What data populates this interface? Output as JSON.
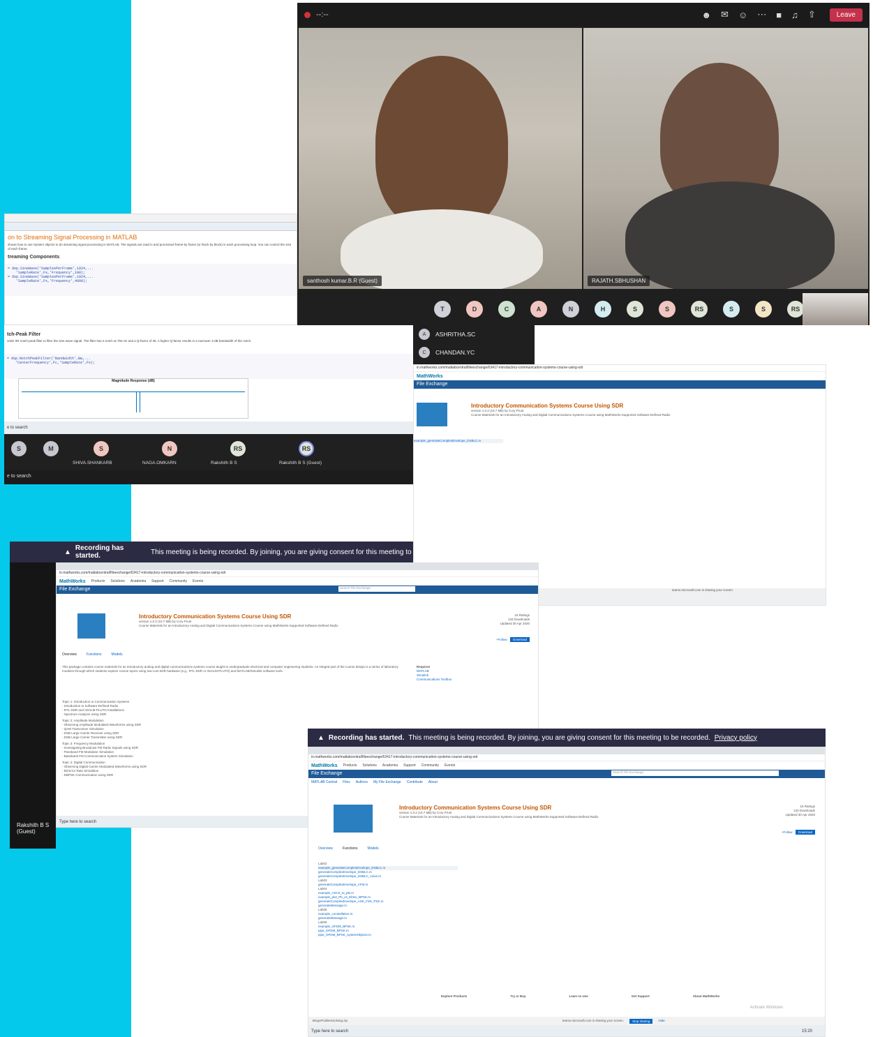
{
  "video_call": {
    "meeting_time": "--:--",
    "leave_label": "Leave",
    "tiles": [
      {
        "name": "santhosh kumar.B.R (Guest)"
      },
      {
        "name": "RAJATH.SBHUSHAN"
      }
    ],
    "avatars": [
      "T",
      "D",
      "C",
      "A",
      "N",
      "H",
      "S",
      "S",
      "RS",
      "S",
      "S",
      "RS"
    ]
  },
  "side_participants": [
    {
      "initial": "A",
      "name": "ASHRITHA.SC"
    },
    {
      "initial": "C",
      "name": "CHANDAN.YC"
    }
  ],
  "matlab": {
    "title": "on to Streaming Signal Processing in MATLAB",
    "intro": "shows how to use System objects to do streaming signal processing in MATLAB. The signals are read in and processed frame by frame (or block by block) in each processing loop. You can control the size of each frame.",
    "section1": "treaming Components",
    "code1": "= dsp.SineWave('SamplesPerFrame',1024,...\n    'SampleRate',Fs,'Frequency',100);\n= dsp.SineWave('SamplesPerFrame',1024,...\n    'SampleRate',Fs,'Frequency',4000);",
    "section2": "tch-Peak Filter",
    "text2": "order IIR notch-peak filter to filter the sine wave signal. The filter has a notch at 750 Hz and a Q-factor of 35. A higher Q-factor results in a narrower 3-dB bandwidth of the notch.",
    "code2": "= dsp.NotchPeakFilter('Bandwidth',Bw,...\n    'CenterFrequency',Fc,'SampleRate',Fs);",
    "plot_title": "Magnitude Response (dB)",
    "search": "e to search"
  },
  "strip": {
    "participants": [
      {
        "initial": "S",
        "name": ""
      },
      {
        "initial": "M",
        "name": ""
      },
      {
        "initial": "S",
        "name": "SHIVA.SHANKARB"
      },
      {
        "initial": "N",
        "name": "NAGA.OMKARN"
      },
      {
        "initial": "RS",
        "name": "Rakshith B S"
      },
      {
        "initial": "RS",
        "name": "Rakshith B S (Guest)"
      }
    ],
    "taskbar_search": "e to search"
  },
  "recording": {
    "bold": "Recording has started.",
    "text": "This meeting is being recorded. By joining, you are giving consent for this meeting to be re",
    "text_full": "This meeting is being recorded. By joining, you are giving consent for this meeting to be recorded.",
    "privacy": "Privacy policy"
  },
  "mathworks": {
    "url": "in.mathworks.com/matlabcentral/fileexchange/63417-introductory-communication-systems-course-using-sdr",
    "logo": "MathWorks",
    "nav": [
      "Products",
      "Solutions",
      "Academia",
      "Support",
      "Community",
      "Events"
    ],
    "section": "File Exchange",
    "search_placeholder": "Search File Exchange",
    "subnav": [
      "MATLAB Central",
      "Files",
      "Authors",
      "My File Exchange",
      "Contribute",
      "About"
    ],
    "title": "Introductory Communication Systems Course Using SDR",
    "version": "version 1.0.2 (10.7 MB) by Cory Prust",
    "summary": "Course Materials for an Introductory Analog and Digital Communications Systems Course using MathWorks-Supported Software-Defined Radio",
    "ratings": "15 Ratings",
    "downloads": "133 Downloads",
    "updated": "Updated 30 Apr 2020",
    "follow": "+Follow",
    "download": "Download",
    "tabs": [
      "Overview",
      "Functions",
      "Models"
    ],
    "overview_text": "This package contains course materials for an introductory analog and digital communications systems course taught to undergraduate electrical and computer engineering students. An integral part of the course design is a series of laboratory modules through which students explore course topics using low-cost SDR hardware (e.g., RTL-SDR or ADALM-PLUTO) and MATLAB/Simulink software tools.",
    "syllabus": [
      "Topic 1: Introduction to Communication Systems",
      "- Introduction to Software-Defined Radio",
      "- RTL-SDR and ADALM-PLUTO Installations",
      "- Spectrum Analyzer using SDR",
      "Topic 2: Amplitude Modulation",
      "- Observing Amplitude Modulated Waveforms using SDR",
      "- QAM Transceiver Simulation",
      "- DSB Large Carrier Receiver using SDR",
      "- DSB Large Carrier Transmitter using SDR",
      "Topic 3: Frequency Modulation",
      "- Investigating Broadcast FM Radio Signals using SDR",
      "- Passband FM Modulator Simulation",
      "- Baseband FM Communication System Simulation",
      "Topic 4: Digital Communication",
      "- Observing Digital Carrier Modulated Waveforms using SDR",
      "- Bit Error Rate Simulation",
      "- DBPSK Communication using SDR"
    ],
    "requires": [
      "Requires",
      "MATLAB",
      "Simulink",
      "Communications Toolbox"
    ],
    "functions": [
      "Lab02",
      "example_generateComplexEnvelope_DSBLC.m",
      "generateComplexEnvelope_DSBLC.m",
      "generateComplexEnvelope_DSBLC_noise.m",
      "Lab03",
      "generateComplexEnvelope_AFM.m",
      "Lab04",
      "example_ASCII_to_pkt.m",
      "example_plot_Pb_vs_EbNo_BPSK.m",
      "generateComplexEnvelope_ASK_FSK_PSK.m",
      "generateMessage.m",
      "Lab05",
      "example_constellation.m",
      "generateMessage.m",
      "Lab06",
      "example_OFDM_BPSK.m",
      "pipe_OFDM_BPSK.m",
      "pipe_OFDM_BPSK_systemObjects.m"
    ],
    "footer": [
      "Explore Products",
      "Try or Buy",
      "Learn to Use",
      "Get Support",
      "About MathWorks"
    ],
    "sharing": "teams.microsoft.com is sharing your screen.",
    "stop_sharing": "Stop sharing",
    "hide": "Hide",
    "taskbar_search": "Type here to search",
    "clock": "15:20",
    "download_file": "BingoProblemSolving.zip",
    "activate": "Activate Windows"
  },
  "guest_label": "Rakshith B S (Guest)"
}
